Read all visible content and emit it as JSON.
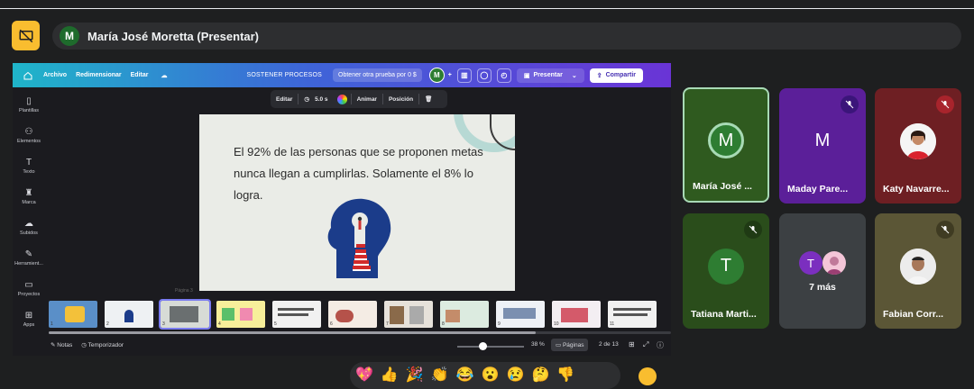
{
  "presenter": {
    "initial": "M",
    "name": "María José Moretta (Presentar)"
  },
  "canva": {
    "menu": {
      "file": "Archivo",
      "resize": "Redimensionar",
      "edit": "Editar",
      "title": "SOSTENER PROCESOS",
      "trial": "Obtener otra prueba por 0 $",
      "avatar": "M",
      "present": "Presentar",
      "share": "Compartir"
    },
    "sidebar": [
      "Plantillas",
      "Elementos",
      "Texto",
      "Marca",
      "Subidos",
      "Herramient...",
      "Proyectos",
      "Apps"
    ],
    "context": {
      "edit": "Editar",
      "duration": "5.0 s",
      "animate": "Animar",
      "position": "Posición"
    },
    "slide_text": "El 92% de las personas que se proponen metas nunca llegan a cumplirlas. Solamente el 8% lo logra.",
    "page_label": "Página 3",
    "thumb_numbers": [
      "1",
      "2",
      "3",
      "4",
      "5",
      "6",
      "7",
      "8",
      "9",
      "10",
      "11"
    ],
    "footer": {
      "notes": "Notas",
      "timer": "Temporizador",
      "zoom": "38 %",
      "pages": "Páginas",
      "page_count": "2 de 13"
    }
  },
  "participants": [
    {
      "name": "María José ...",
      "initial": "M"
    },
    {
      "name": "Maday Pare...",
      "initial": "M"
    },
    {
      "name": "Katy Navarre..."
    },
    {
      "name": "Tatiana Marti...",
      "initial": "T"
    },
    {
      "name": "7 más",
      "initials": [
        "T"
      ]
    },
    {
      "name": "Fabian Corr..."
    }
  ],
  "reactions": [
    "💖",
    "👍",
    "🎉",
    "👏",
    "😂",
    "😮",
    "😢",
    "🤔",
    "👎"
  ],
  "colors": {
    "accent": "#f9bd2f",
    "tile_active_border": "#a8dab5"
  }
}
